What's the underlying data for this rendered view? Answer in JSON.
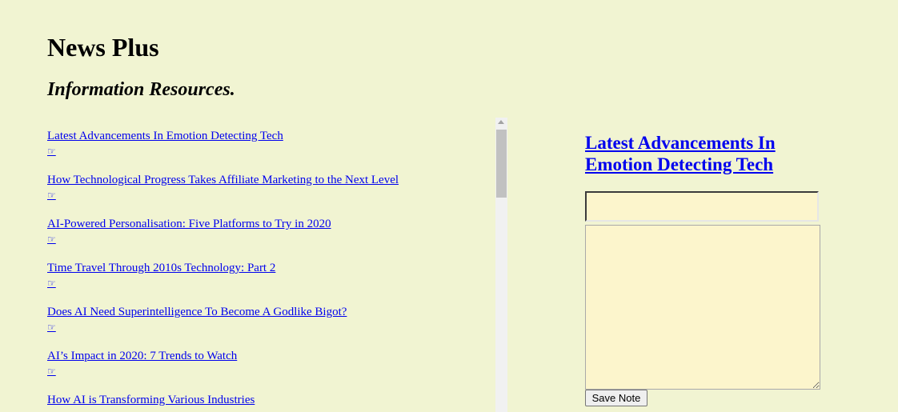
{
  "header": {
    "title": "News Plus",
    "subtitle": "Information Resources."
  },
  "articles": [
    {
      "title": "Latest Advancements In Emotion Detecting Tech",
      "marker": "☞"
    },
    {
      "title": "How Technological Progress Takes Affiliate Marketing to the Next Level",
      "marker": "☞"
    },
    {
      "title": "AI-Powered Personalisation: Five Platforms to Try in 2020",
      "marker": "☞"
    },
    {
      "title": "Time Travel Through 2010s Technology: Part 2",
      "marker": "☞"
    },
    {
      "title": "Does AI Need Superintelligence To Become A Godlike Bigot?",
      "marker": "☞"
    },
    {
      "title": "AI’s Impact in 2020: 7 Trends to Watch",
      "marker": "☞"
    },
    {
      "title": "How AI is Transforming Various Industries",
      "marker": "☞"
    }
  ],
  "note": {
    "heading": "Latest Advancements In Emotion Detecting Tech",
    "title_value": "",
    "body_value": "",
    "save_label": "Save Note"
  },
  "colors": {
    "background": "#f1f4d2",
    "link": "#0000ee",
    "input_background": "#fcf5cc"
  }
}
